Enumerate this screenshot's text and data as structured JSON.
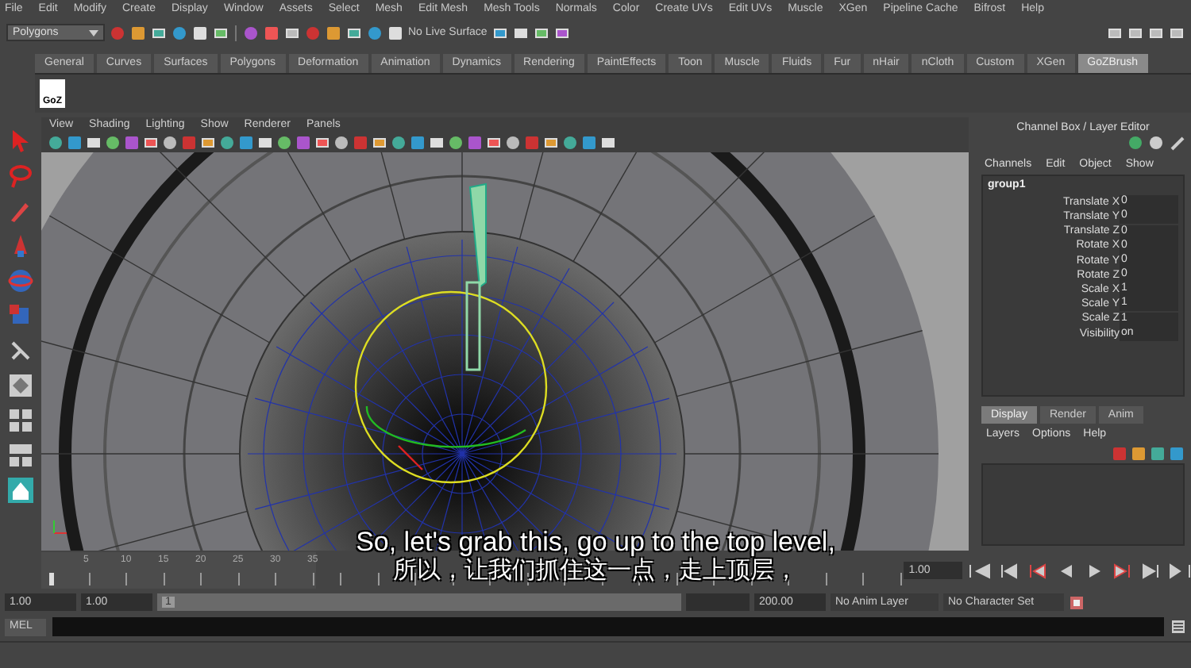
{
  "menu_bar": [
    "File",
    "Edit",
    "Modify",
    "Create",
    "Display",
    "Window",
    "Assets",
    "Select",
    "Mesh",
    "Edit Mesh",
    "Mesh Tools",
    "Normals",
    "Color",
    "Create UVs",
    "Edit UVs",
    "Muscle",
    "XGen",
    "Pipeline Cache",
    "Bifrost",
    "Help"
  ],
  "status_line": {
    "mode": "Polygons",
    "live_surface": "No Live Surface"
  },
  "shelf_tabs": [
    {
      "label": "General",
      "selected": false
    },
    {
      "label": "Curves",
      "selected": false
    },
    {
      "label": "Surfaces",
      "selected": false
    },
    {
      "label": "Polygons",
      "selected": false
    },
    {
      "label": "Deformation",
      "selected": false
    },
    {
      "label": "Animation",
      "selected": false
    },
    {
      "label": "Dynamics",
      "selected": false
    },
    {
      "label": "Rendering",
      "selected": false
    },
    {
      "label": "PaintEffects",
      "selected": false
    },
    {
      "label": "Toon",
      "selected": false
    },
    {
      "label": "Muscle",
      "selected": false
    },
    {
      "label": "Fluids",
      "selected": false
    },
    {
      "label": "Fur",
      "selected": false
    },
    {
      "label": "nHair",
      "selected": false
    },
    {
      "label": "nCloth",
      "selected": false
    },
    {
      "label": "Custom",
      "selected": false
    },
    {
      "label": "XGen",
      "selected": false
    },
    {
      "label": "GoZBrush",
      "selected": true
    }
  ],
  "shelf_button": {
    "label": "GoZ"
  },
  "panel_menu": [
    "View",
    "Shading",
    "Lighting",
    "Show",
    "Renderer",
    "Panels"
  ],
  "channel_box": {
    "title": "Channel Box / Layer Editor",
    "menus": [
      "Channels",
      "Edit",
      "Object",
      "Show"
    ],
    "object": "group1",
    "channels": [
      {
        "name": "Translate X",
        "value": "0"
      },
      {
        "name": "Translate Y",
        "value": "0"
      },
      {
        "name": "Translate Z",
        "value": "0"
      },
      {
        "name": "Rotate X",
        "value": "0"
      },
      {
        "name": "Rotate Y",
        "value": "0"
      },
      {
        "name": "Rotate Z",
        "value": "0"
      },
      {
        "name": "Scale X",
        "value": "1"
      },
      {
        "name": "Scale Y",
        "value": "1"
      },
      {
        "name": "Scale Z",
        "value": "1"
      },
      {
        "name": "Visibility",
        "value": "on"
      }
    ]
  },
  "layer_editor": {
    "tabs": [
      {
        "label": "Display",
        "selected": true
      },
      {
        "label": "Render",
        "selected": false
      },
      {
        "label": "Anim",
        "selected": false
      }
    ],
    "menus": [
      "Layers",
      "Options",
      "Help"
    ]
  },
  "timeline": {
    "ticks": [
      "5",
      "10",
      "15",
      "20",
      "25",
      "30",
      "35"
    ],
    "current_time": "1.00"
  },
  "range_slider": {
    "start_time": "1.00",
    "playback_start": "1.00",
    "handle": "1",
    "end_time": "200.00",
    "anim_layer": "No Anim Layer",
    "character_set": "No Character Set"
  },
  "command_line": {
    "label": "MEL"
  },
  "subtitles": [
    "So, let's grab this, go up to the top level,",
    "所以，让我们抓住这一点，走上顶层，"
  ]
}
